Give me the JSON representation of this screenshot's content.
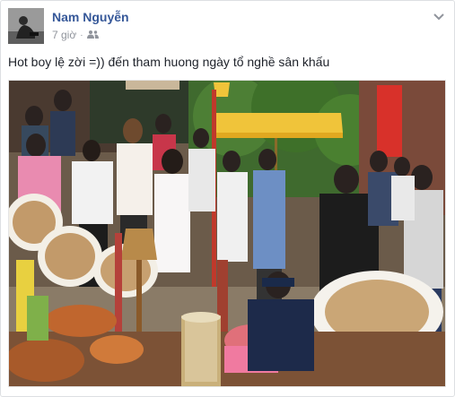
{
  "post": {
    "author_name": "Nam Nguyễn",
    "time": "7 giờ",
    "separator": "·",
    "audience_icon": "friends-icon",
    "menu_icon": "chevron-down-icon",
    "message": "Hot boy lệ zời =)) đến tham huong ngày tổ nghề sân khấu"
  },
  "colors": {
    "author_link": "#365899",
    "meta_gray": "#90949c",
    "umbrella_yellow": "#f0c43a",
    "banner_red": "#d8312a"
  }
}
